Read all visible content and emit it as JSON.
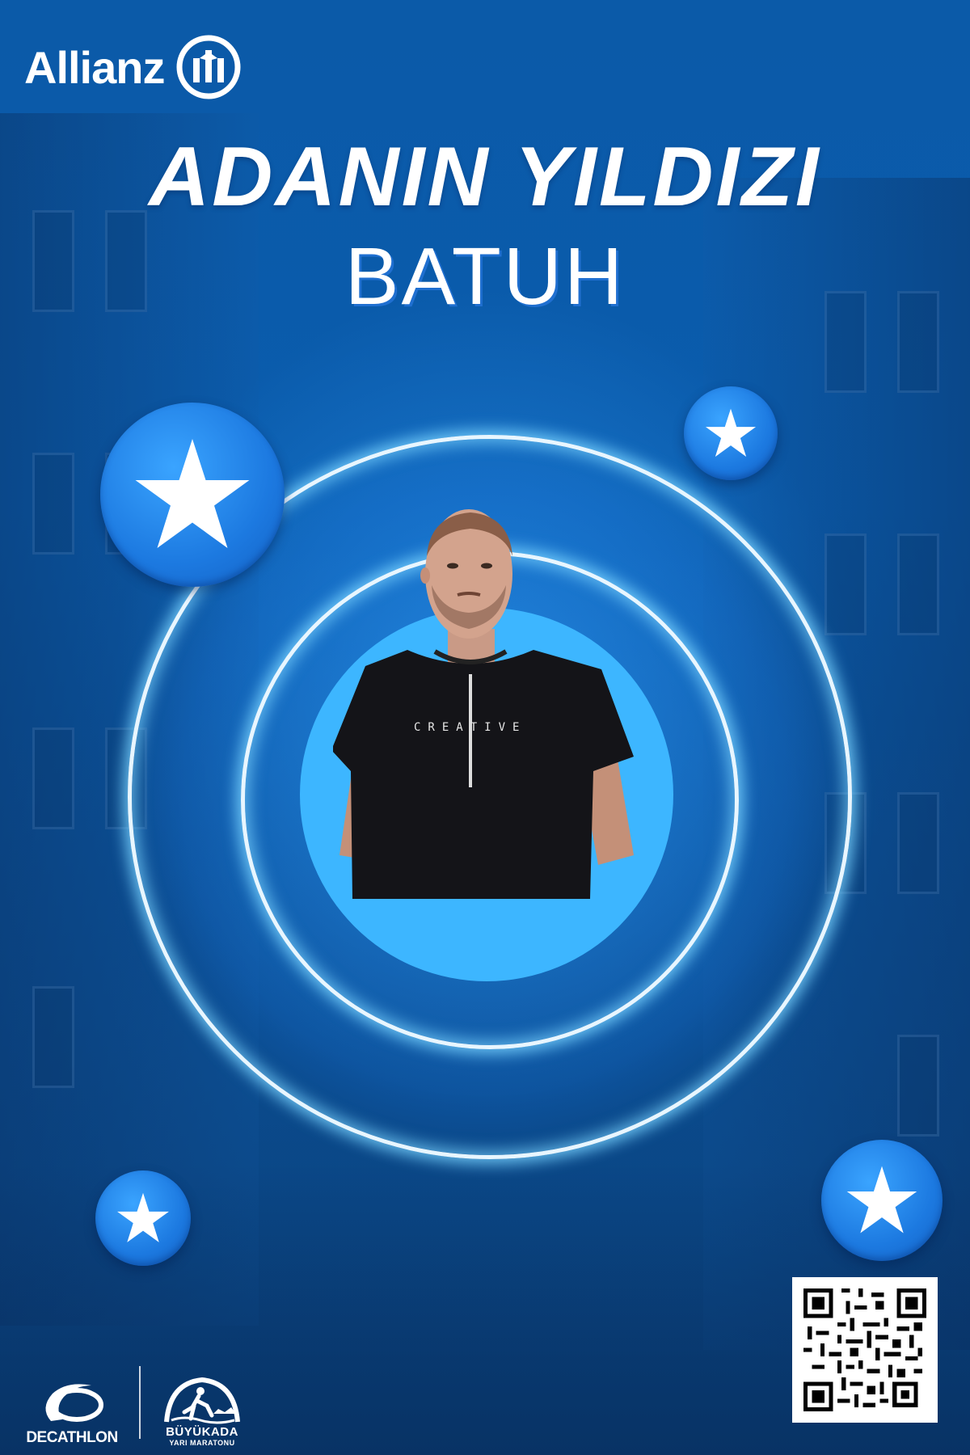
{
  "brand": {
    "name": "Allianz",
    "emblem_icon": "allianz-eagle-emblem"
  },
  "headline": {
    "title": "ADANIN YILDIZI",
    "name": "BATUH"
  },
  "portrait": {
    "shirt_text": "CREATIVE"
  },
  "stars": [
    "star-icon",
    "star-icon",
    "star-icon",
    "star-icon"
  ],
  "qr": {
    "icon": "qr-code"
  },
  "sponsors": {
    "decathlon": "DECATHLON",
    "race_name": "BÜYÜKADA",
    "race_sub": "YARI MARATONU"
  },
  "colors": {
    "background": "#0b5aa8",
    "disc": "#3db6ff",
    "ring": "#e8f6ff",
    "badge": "#1c79e0",
    "name_shadow": "#1f6fd0"
  }
}
